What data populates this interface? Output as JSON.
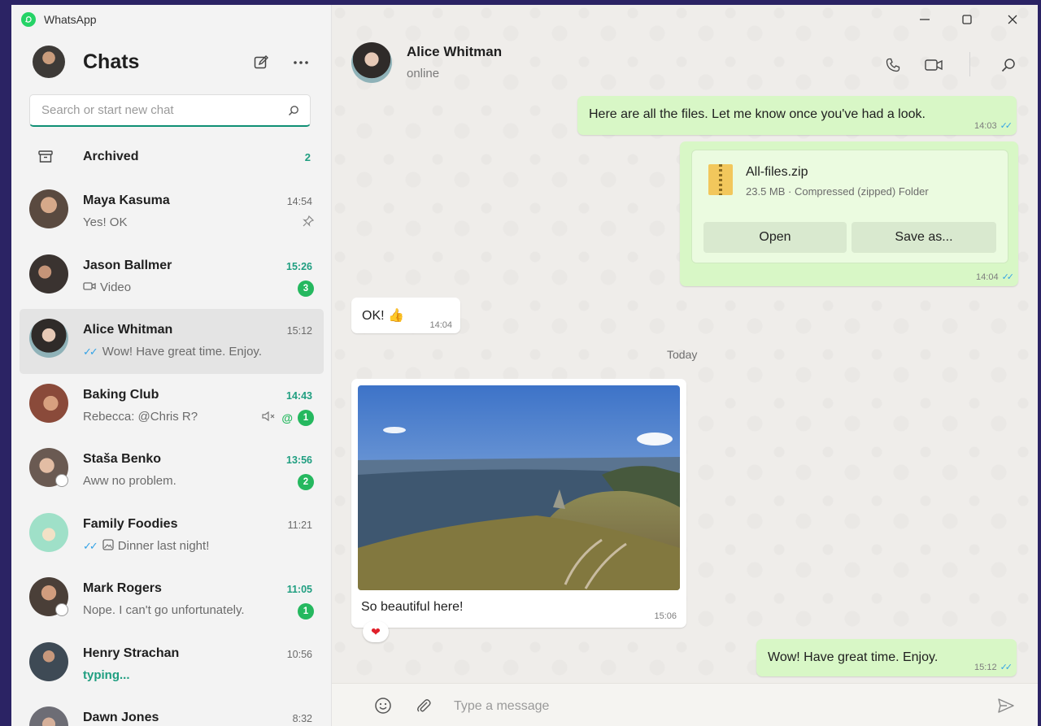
{
  "app": {
    "name": "WhatsApp"
  },
  "sidebar": {
    "title": "Chats",
    "search_placeholder": "Search or start new chat",
    "archived": {
      "label": "Archived",
      "count": "2"
    },
    "chats": [
      {
        "name": "Maya Kasuma",
        "preview": "Yes! OK",
        "time": "14:54",
        "unread": "",
        "pinned": true,
        "avatar_color": "#5a4a40"
      },
      {
        "name": "Jason Ballmer",
        "preview": "Video",
        "time": "15:26",
        "unread": "3",
        "preview_icon": "video-icon",
        "avatar_color": "#3a3330"
      },
      {
        "name": "Alice Whitman",
        "preview": "Wow! Have great time. Enjoy.",
        "time": "15:12",
        "unread": "",
        "ticks": "✓✓",
        "active": true,
        "avatar_color": "#2f2b29"
      },
      {
        "name": "Baking Club",
        "preview": "Rebecca: @Chris R?",
        "time": "14:43",
        "unread": "1",
        "muted": true,
        "mention": "@",
        "avatar_color": "#8a4a3a"
      },
      {
        "name": "Staša Benko",
        "preview": "Aww no problem.",
        "time": "13:56",
        "unread": "2",
        "avatar_color": "#6a5a52"
      },
      {
        "name": "Family Foodies",
        "preview": "Dinner last night!",
        "time": "11:21",
        "unread": "",
        "ticks": "✓✓",
        "preview_icon": "photo-icon",
        "avatar_color": "#9fe0c8"
      },
      {
        "name": "Mark Rogers",
        "preview": "Nope. I can't go unfortunately.",
        "time": "11:05",
        "unread": "1",
        "avatar_color": "#4a3f38"
      },
      {
        "name": "Henry Strachan",
        "preview": "typing...",
        "time": "10:56",
        "unread": "",
        "typing": true,
        "avatar_color": "#3e4a55"
      },
      {
        "name": "Dawn Jones",
        "preview": "",
        "time": "8:32",
        "unread": "",
        "avatar_color": "#6d6d75"
      }
    ]
  },
  "chat": {
    "contact_name": "Alice Whitman",
    "contact_status": "online",
    "messages": {
      "m1": {
        "text": "Here are all the files. Let me know once you've had a look.",
        "time": "14:03",
        "ticks": "✓✓"
      },
      "file": {
        "name": "All-files.zip",
        "meta": "23.5 MB · Compressed (zipped) Folder",
        "open_label": "Open",
        "save_label": "Save as...",
        "time": "14:04",
        "ticks": "✓✓"
      },
      "m2": {
        "text": "OK! 👍",
        "time": "14:04"
      },
      "date_divider": "Today",
      "photo": {
        "caption": "So beautiful here!",
        "time": "15:06",
        "reaction": "❤"
      },
      "m3": {
        "text": "Wow! Have great time. Enjoy.",
        "time": "15:12",
        "ticks": "✓✓"
      }
    },
    "composer_placeholder": "Type a message"
  },
  "colors": {
    "accent": "#25b85f",
    "outgoing_bubble": "#d8f7c6",
    "read_ticks": "#34a3e6"
  }
}
